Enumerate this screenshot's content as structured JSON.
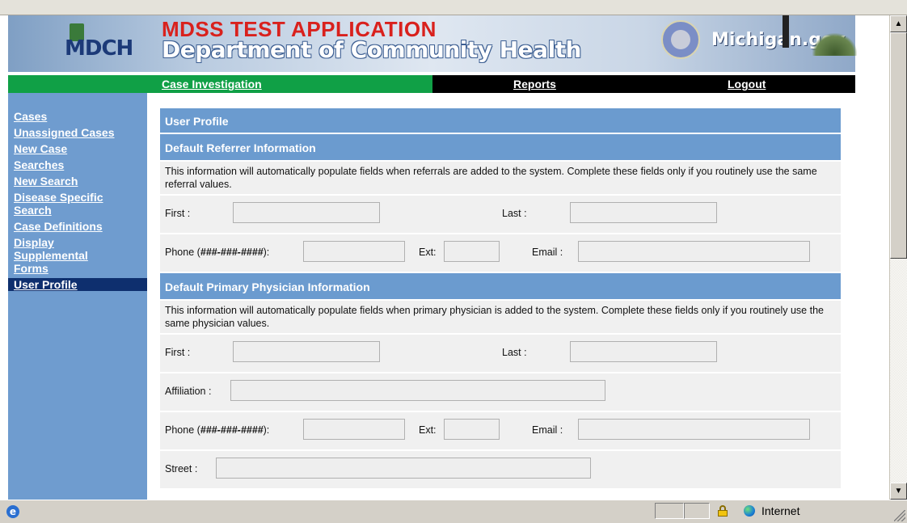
{
  "banner": {
    "app_title": "MDSS TEST APPLICATION",
    "dept_title": "Department of Community Health",
    "logo_text": "MDCH",
    "brand_text": "Michigan.gov"
  },
  "nav": {
    "case_investigation": "Case Investigation",
    "reports": "Reports",
    "logout": "Logout"
  },
  "sidebar": {
    "items": [
      {
        "label": "Cases"
      },
      {
        "label": "Unassigned Cases"
      },
      {
        "label": "New Case"
      },
      {
        "label": "Searches"
      },
      {
        "label": "New Search"
      },
      {
        "label": "Disease Specific Search"
      },
      {
        "label": "Case Definitions"
      },
      {
        "label": "Display Supplemental Forms"
      },
      {
        "label": "User Profile"
      }
    ],
    "active": "User Profile"
  },
  "profile": {
    "title": "User Profile",
    "referrer": {
      "header": "Default Referrer Information",
      "info": "This information will automatically populate fields when referrals are added to the system. Complete these fields only if you routinely use the same referral values.",
      "first_label": "First :",
      "last_label": "Last :",
      "phone_label_pre": "Phone (",
      "phone_format": "###-###-####",
      "phone_label_post": "):",
      "ext_label": "Ext:",
      "email_label": "Email :",
      "first_value": "",
      "last_value": "",
      "phone_value": "",
      "ext_value": "",
      "email_value": ""
    },
    "physician": {
      "header": "Default Primary Physician Information",
      "info": "This information will automatically populate fields when primary physician is added to the system. Complete these fields only if you routinely use the same physician values.",
      "first_label": "First :",
      "last_label": "Last :",
      "affiliation_label": "Affiliation :",
      "phone_label_pre": "Phone (",
      "phone_format": "###-###-####",
      "phone_label_post": "):",
      "ext_label": "Ext:",
      "email_label": "Email :",
      "street_label": "Street :",
      "first_value": "",
      "last_value": "",
      "affiliation_value": "",
      "phone_value": "",
      "ext_value": "",
      "email_value": "",
      "street_value": ""
    }
  },
  "status": {
    "zone": "Internet"
  },
  "colors": {
    "header_blue": "#6b9bcf",
    "sidebar_blue": "#6f9ccf",
    "active_navy": "#0e2f6e",
    "nav_green": "#10a046",
    "title_red": "#d9211d"
  }
}
